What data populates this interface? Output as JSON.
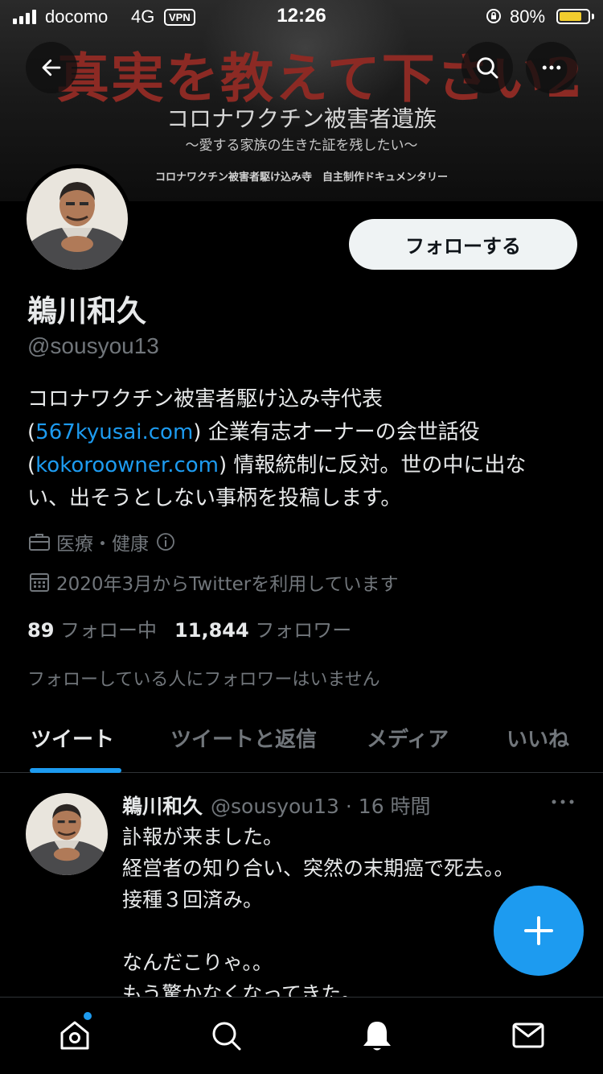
{
  "status_bar": {
    "carrier": "docomo",
    "network": "4G",
    "vpn": "VPN",
    "time": "12:26",
    "battery_percent": "80%",
    "battery_level": 0.8
  },
  "banner": {
    "title": "真実を教えて下さい2",
    "subtitle": "コロナワクチン被害者遺族",
    "tagline": "〜愛する家族の生きた証を残したい〜",
    "credit": "コロナワクチン被害者駆け込み寺　自主制作ドキュメンタリー"
  },
  "profile": {
    "follow_label": "フォローする",
    "display_name": "鵜川和久",
    "handle": "@sousyou13",
    "bio_line1": "コロナワクチン被害者駆け込み寺代表",
    "bio_paren_open1": "(",
    "bio_link1": "567kyusai.com",
    "bio_after1": ") 企業有志オーナーの会世話役",
    "bio_paren_open2": "(",
    "bio_link2": "kokoroowner.com",
    "bio_after2": ") 情報統制に反対。世の中に出な",
    "bio_line4": "い、出そうとしない事柄を投稿します。",
    "category": "医療・健康",
    "joined": "2020年3月からTwitterを利用しています",
    "following_count": "89",
    "following_label": "フォロー中",
    "followers_count": "11,844",
    "followers_label": "フォロワー",
    "followed_by_note": "フォローしている人にフォロワーはいません"
  },
  "tabs": [
    {
      "label": "ツイート",
      "active": true
    },
    {
      "label": "ツイートと返信",
      "active": false
    },
    {
      "label": "メディア",
      "active": false
    },
    {
      "label": "いいね",
      "active": false
    }
  ],
  "tweet": {
    "name": "鵜川和久",
    "meta": "@sousyou13 · 16 時間",
    "body": "訃報が来ました。\n経営者の知り合い、突然の末期癌で死去。。\n接種３回済み。\n\nなんだこりゃ。。\nもう驚かなくなってきた。"
  },
  "colors": {
    "accent": "#1d9bf0",
    "background": "#000000",
    "secondary_text": "#71767b",
    "banner_title": "#8c2a24"
  },
  "icons": {
    "back": "arrow-left-icon",
    "search": "search-icon",
    "more": "more-horizontal-icon",
    "category": "briefcase-icon",
    "info": "info-icon",
    "calendar": "calendar-icon",
    "fab": "plus-icon",
    "nav": [
      "home-icon",
      "search-icon",
      "notifications-icon",
      "messages-icon"
    ]
  }
}
